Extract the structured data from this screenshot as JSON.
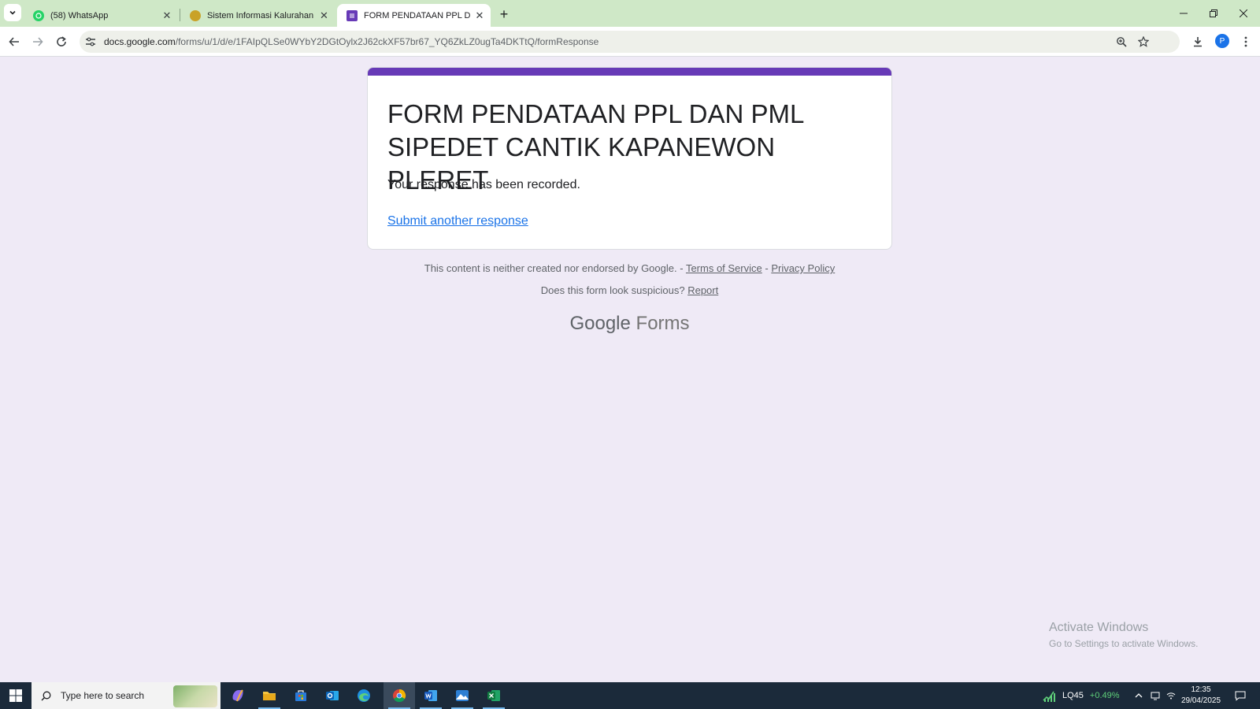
{
  "browser": {
    "tabs": [
      {
        "title": "(58) WhatsApp",
        "icon": "whatsapp-icon",
        "color": "#25d366"
      },
      {
        "title": "Sistem Informasi Kalurahan Pleret",
        "icon": "kalurahan-logo-icon",
        "color": "#c9a227"
      },
      {
        "title": "FORM PENDATAAN PPL DAN PML",
        "icon": "google-forms-icon",
        "color": "#673ab7",
        "active": true
      }
    ],
    "url_host": "docs.google.com",
    "url_path": "/forms/u/1/d/e/1FAIpQLSe0WYbY2DGtOylx2J62ckXF57br67_YQ6ZkLZ0ugTa4DKTtQ/formResponse",
    "profile_initial": "P",
    "accent_color": "#cfe8c7"
  },
  "form": {
    "title": "FORM PENDATAAN PPL DAN PML SIPEDET CANTIK KAPANEWON PLERET",
    "message": "Your response has been recorded.",
    "link": "Submit another response",
    "accent_color": "#673ab7"
  },
  "footer": {
    "disclaimer": "This content is neither created nor endorsed by Google.",
    "sep1": " - ",
    "terms": "Terms of Service",
    "sep2": " - ",
    "privacy": "Privacy Policy",
    "suspicious": "Does this form look suspicious?",
    "report": "Report",
    "brand_google": "Google",
    "brand_forms": "Forms"
  },
  "watermark": {
    "line1": "Activate Windows",
    "line2": "Go to Settings to activate Windows."
  },
  "taskbar": {
    "search_placeholder": "Type here to search",
    "apps": [
      "copilot-icon",
      "file-explorer-icon",
      "store-icon",
      "outlook-icon",
      "edge-icon",
      "chrome-icon",
      "word-icon",
      "photos-icon",
      "excel-icon"
    ],
    "stock_name": "LQ45",
    "stock_change": "+0.49%",
    "time": "12:35",
    "date": "29/04/2025"
  }
}
